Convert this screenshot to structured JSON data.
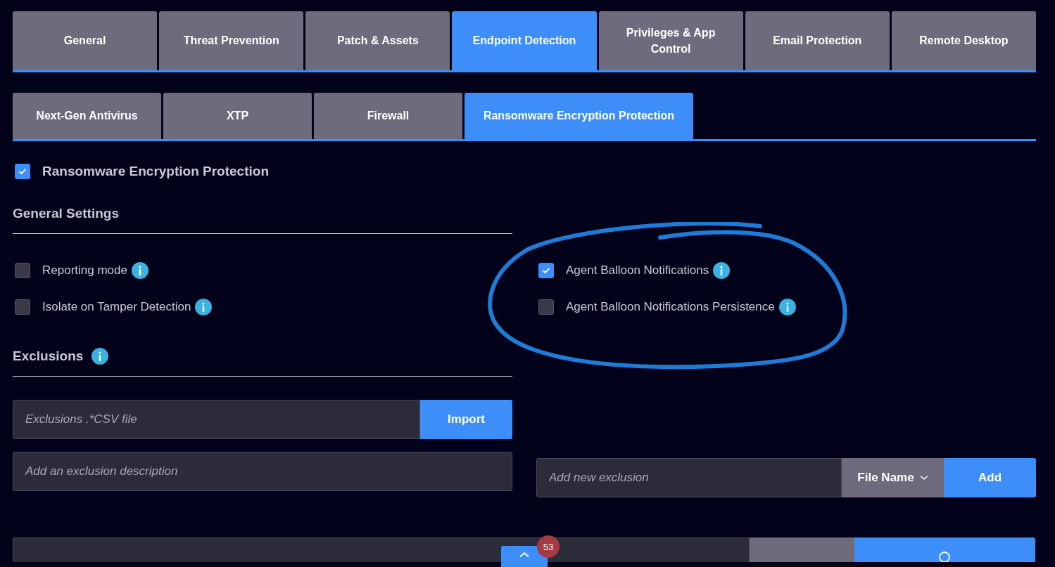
{
  "main_tabs": [
    {
      "label": "General",
      "selected": false
    },
    {
      "label": "Threat Prevention",
      "selected": false
    },
    {
      "label": "Patch & Assets",
      "selected": false
    },
    {
      "label": "Endpoint Detection",
      "selected": true
    },
    {
      "label": "Privileges & App Control",
      "selected": false
    },
    {
      "label": "Email Protection",
      "selected": false
    },
    {
      "label": "Remote Desktop",
      "selected": false
    }
  ],
  "sub_tabs": [
    {
      "label": "Next-Gen Antivirus",
      "selected": false
    },
    {
      "label": "XTP",
      "selected": false
    },
    {
      "label": "Firewall",
      "selected": false
    },
    {
      "label": "Ransomware Encryption Protection",
      "selected": true
    }
  ],
  "enable": {
    "label": "Ransomware Encryption Protection",
    "checked": true
  },
  "general_settings": {
    "title": "General Settings",
    "left_options": [
      {
        "label": "Reporting mode",
        "checked": false
      },
      {
        "label": "Isolate on Tamper Detection",
        "checked": false
      }
    ],
    "right_options": [
      {
        "label": "Agent Balloon Notifications",
        "checked": true
      },
      {
        "label": "Agent Balloon Notifications Persistence",
        "checked": false
      }
    ]
  },
  "exclusions": {
    "title": "Exclusions",
    "import_field": {
      "placeholder": "Exclusions .*CSV file"
    },
    "import_button": "Import",
    "description_field": {
      "placeholder": "Add an exclusion description"
    },
    "new_exclusion_field": {
      "placeholder": "Add new exclusion"
    },
    "type_dropdown": "File Name",
    "add_button": "Add"
  },
  "scroll_top_button": {
    "badge": "53"
  }
}
